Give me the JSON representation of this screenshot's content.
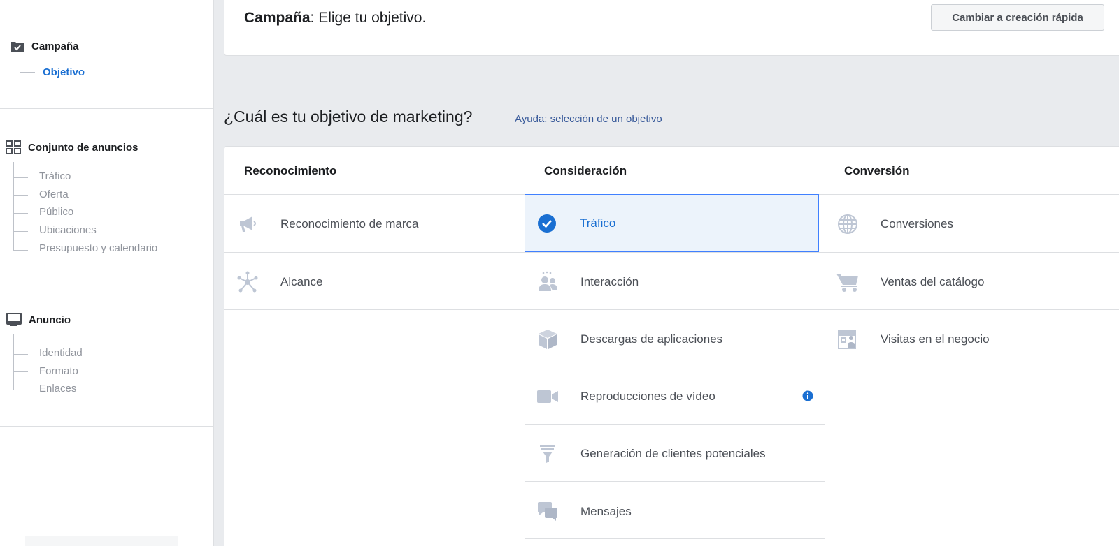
{
  "sidebar": {
    "campaign": {
      "title": "Campaña",
      "active_item": "Objetivo"
    },
    "adset": {
      "title": "Conjunto de anuncios",
      "items": [
        "Tráfico",
        "Oferta",
        "Público",
        "Ubicaciones",
        "Presupuesto y calendario"
      ]
    },
    "ad": {
      "title": "Anuncio",
      "items": [
        "Identidad",
        "Formato",
        "Enlaces"
      ]
    }
  },
  "header": {
    "title_bold": "Campaña",
    "title_rest": ": Elige tu objetivo.",
    "quick_button": "Cambiar a creación rápida"
  },
  "question": {
    "text": "¿Cuál es tu objetivo de marketing?",
    "help_link": "Ayuda: selección de un objetivo"
  },
  "columns": [
    {
      "title": "Reconocimiento",
      "objectives": [
        "Reconocimiento de marca",
        "Alcance"
      ]
    },
    {
      "title": "Consideración",
      "objectives": [
        "Tráfico",
        "Interacción",
        "Descargas de aplicaciones",
        "Reproducciones de vídeo",
        "Generación de clientes potenciales",
        "Mensajes"
      ]
    },
    {
      "title": "Conversión",
      "objectives": [
        "Conversiones",
        "Ventas del catálogo",
        "Visitas en el negocio"
      ]
    }
  ],
  "selected_objective": "Tráfico",
  "colors": {
    "accent": "#1a6fd2",
    "selected_bg": "#ecf3fb",
    "selected_border": "#4080ff",
    "icon": "#bec6d4"
  },
  "icons": {
    "brand-awareness": "megaphone-icon",
    "reach": "network-icon",
    "traffic": "check-circle-icon",
    "engagement": "people-icon",
    "app-installs": "box-icon",
    "video-views": "video-camera-icon",
    "lead-generation": "funnel-icon",
    "messages": "chat-bubbles-icon",
    "conversions": "globe-icon",
    "catalog-sales": "cart-icon",
    "store-visits": "store-icon",
    "video-info": "info-icon"
  }
}
